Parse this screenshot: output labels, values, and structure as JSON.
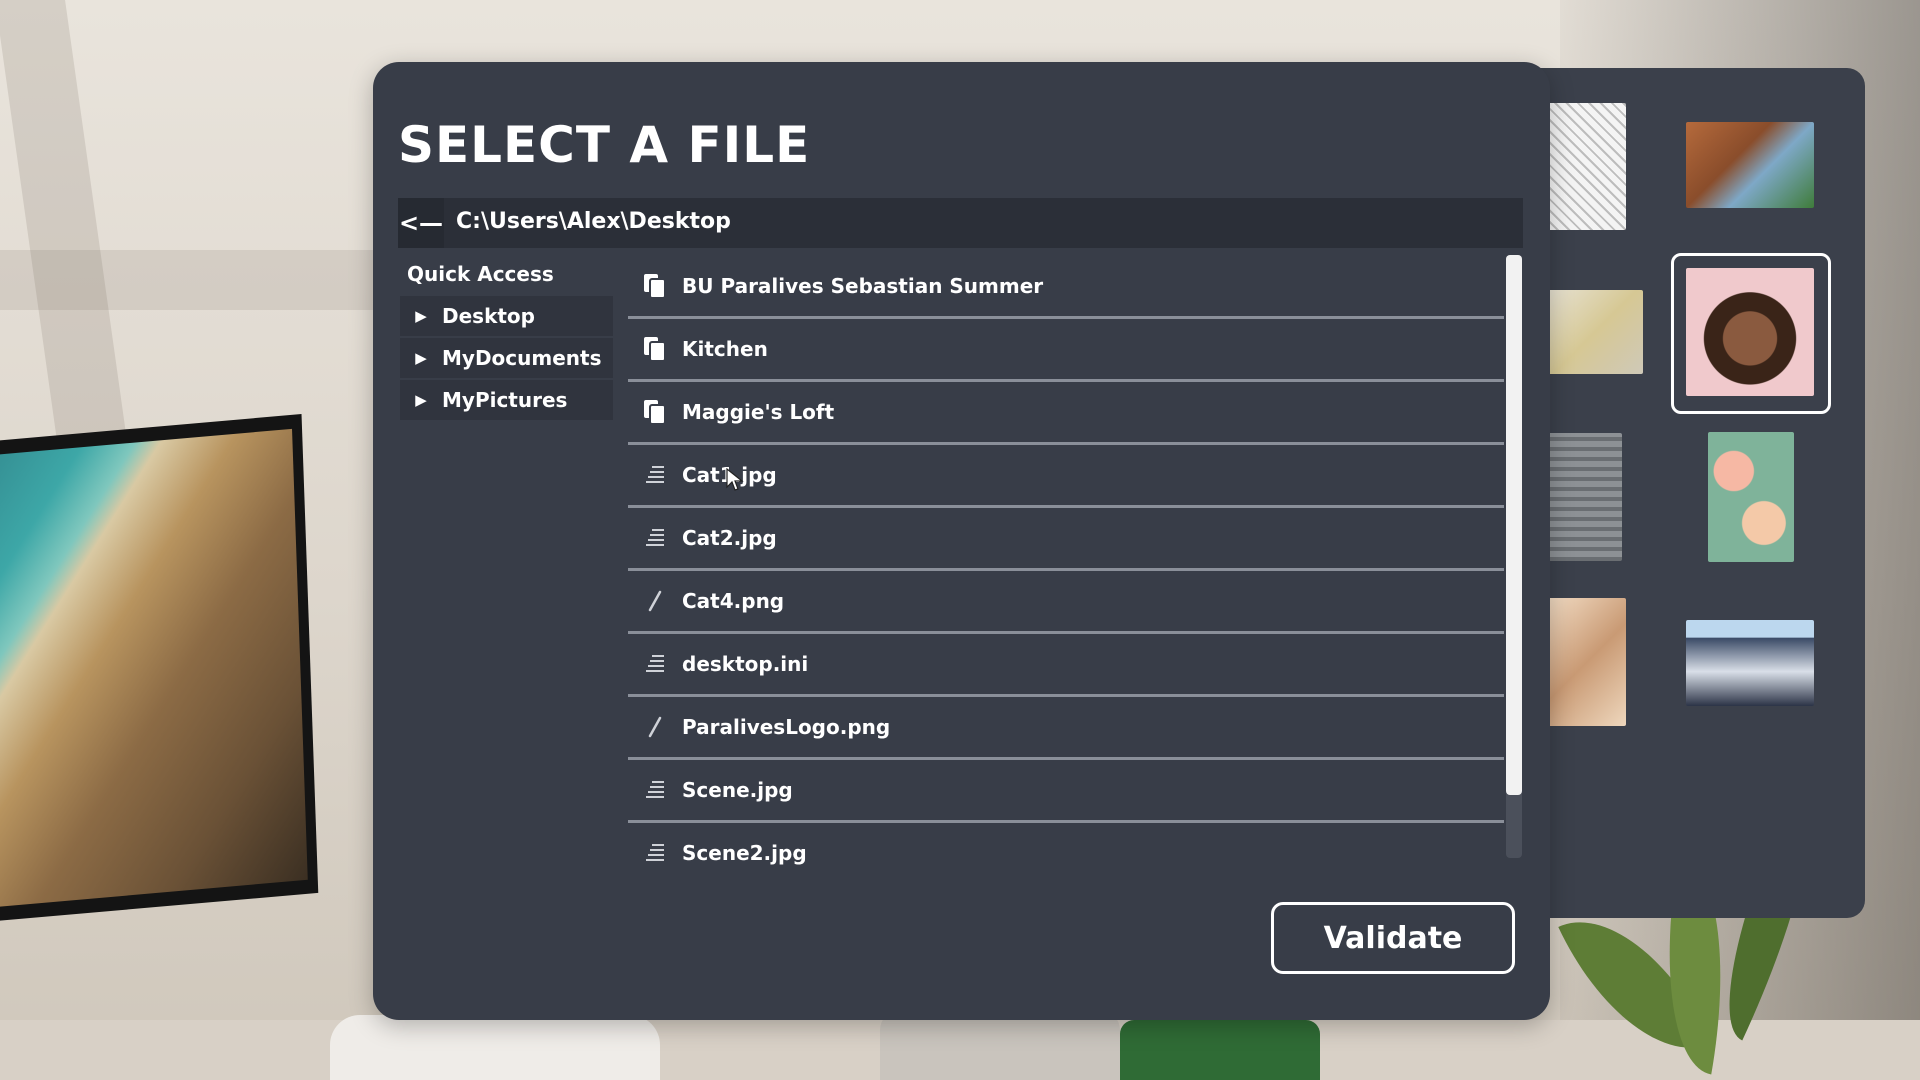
{
  "dialog": {
    "title": "SELECT A FILE",
    "back_label": "<—",
    "path": "C:\\Users\\Alex\\Desktop",
    "validate_label": "Validate"
  },
  "quick_access": {
    "heading": "Quick Access",
    "items": [
      {
        "label": "Desktop",
        "icon": "triangle-right-icon"
      },
      {
        "label": "MyDocuments",
        "icon": "triangle-right-icon"
      },
      {
        "label": "MyPictures",
        "icon": "triangle-right-icon"
      }
    ]
  },
  "files": [
    {
      "name": "BU Paralives Sebastian Summer",
      "icon": "folder-icon"
    },
    {
      "name": "Kitchen",
      "icon": "folder-icon"
    },
    {
      "name": "Maggie's Loft",
      "icon": "folder-icon"
    },
    {
      "name": "Cat1.jpg",
      "icon": "file-lines-icon"
    },
    {
      "name": "Cat2.jpg",
      "icon": "file-lines-icon"
    },
    {
      "name": "Cat4.png",
      "icon": "pencil-icon"
    },
    {
      "name": "desktop.ini",
      "icon": "file-lines-icon"
    },
    {
      "name": "ParalivesLogo.png",
      "icon": "pencil-icon"
    },
    {
      "name": "Scene.jpg",
      "icon": "file-lines-icon"
    },
    {
      "name": "Scene2.jpg",
      "icon": "file-lines-icon"
    }
  ],
  "colors": {
    "dialog_bg": "#383d48",
    "path_bar_bg": "#2b2f38",
    "quick_access_item_bg": "#30343e",
    "text": "#ffffff",
    "divider": "#8a8f99"
  }
}
